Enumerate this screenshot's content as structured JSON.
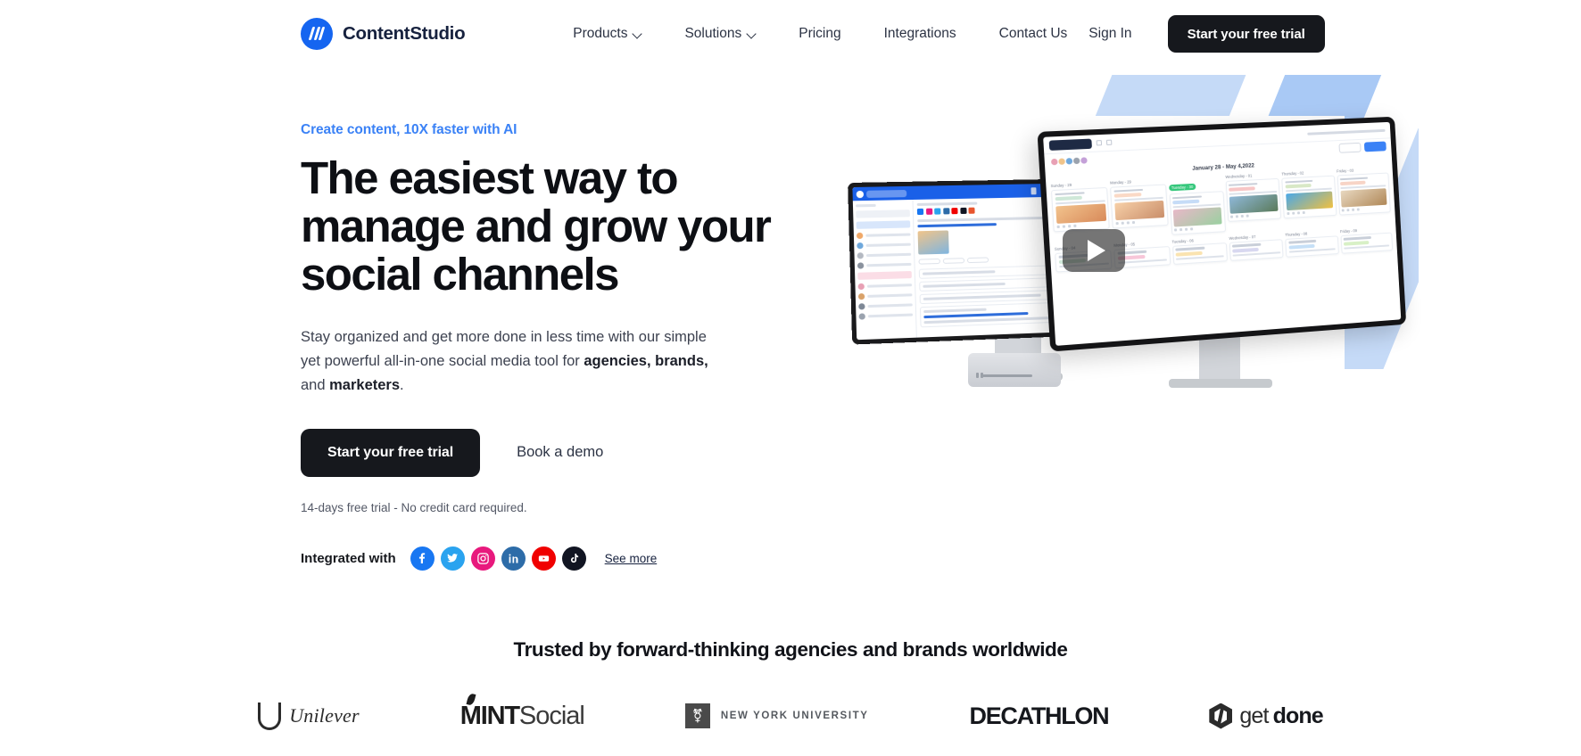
{
  "brand": {
    "name": "ContentStudio",
    "logo_icon": "contentstudio-logo-icon",
    "accent": "#1565f0"
  },
  "nav": {
    "items": [
      {
        "label": "Products",
        "has_dropdown": true
      },
      {
        "label": "Solutions",
        "has_dropdown": true
      },
      {
        "label": "Pricing",
        "has_dropdown": false
      },
      {
        "label": "Integrations",
        "has_dropdown": false
      },
      {
        "label": "Contact Us",
        "has_dropdown": false
      }
    ],
    "sign_in": "Sign In",
    "cta": "Start your free trial"
  },
  "hero": {
    "eyebrow": "Create content, 10X faster with AI",
    "headline_line1": "The easiest way to",
    "headline_line2": "manage and grow your",
    "headline_line3": "social channels",
    "subcopy_part1": "Stay organized and get more done in less time with our simple yet powerful all-in-one social media tool for ",
    "subcopy_bold1": "agencies, brands,",
    "subcopy_part2": " and ",
    "subcopy_bold2": "marketers",
    "subcopy_part3": ".",
    "cta_primary": "Start your free trial",
    "cta_secondary": "Book a demo",
    "trial_note": "14-days free trial - No credit card required.",
    "integrated_label": "Integrated with",
    "see_more": "See more",
    "socials": [
      {
        "name": "facebook-icon",
        "color": "#1877f2"
      },
      {
        "name": "twitter-icon",
        "color": "#2aa3ef"
      },
      {
        "name": "instagram-icon",
        "color": "#e8197d"
      },
      {
        "name": "linkedin-icon",
        "color": "#2d6ca8"
      },
      {
        "name": "youtube-icon",
        "color": "#f00000"
      },
      {
        "name": "tiktok-icon",
        "color": "#111522"
      }
    ],
    "video": {
      "play_button": "play-button",
      "screen_title": "January 28 - May 4,2022",
      "active_day": "Tuesday - 30",
      "days": [
        "Sunday - 29",
        "Monday - 29",
        "Tuesday - 30",
        "Wednesday - 01",
        "Thursday - 02",
        "Friday - 03"
      ],
      "days_row2": [
        "Sunday - 04",
        "Monday - 05",
        "Tuesday - 06",
        "Wednesday - 07",
        "Thursday - 08",
        "Friday - 09"
      ]
    }
  },
  "trusted": {
    "title": "Trusted by forward-thinking agencies and brands worldwide",
    "logos": [
      {
        "name": "unilever-logo",
        "text": "Unilever"
      },
      {
        "name": "mintsocial-logo",
        "text_bold": "MINT",
        "text_light": "Social"
      },
      {
        "name": "nyu-logo",
        "text": "NEW YORK UNIVERSITY"
      },
      {
        "name": "decathlon-logo",
        "text": "DECATHLON"
      },
      {
        "name": "getdone-logo",
        "text_light": "get",
        "text_bold": "done"
      }
    ]
  }
}
